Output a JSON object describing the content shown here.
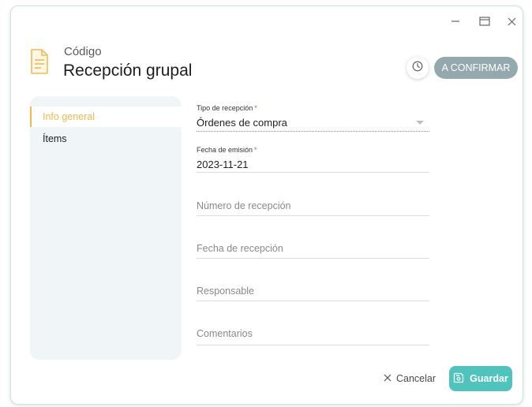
{
  "header": {
    "code_label": "Código",
    "title": "Recepción grupal",
    "confirm_label": "A CONFIRMAR"
  },
  "window_controls": [
    "minimize-icon",
    "maximize-icon",
    "close-icon"
  ],
  "sidebar": {
    "items": [
      {
        "label": "Info general",
        "active": true
      },
      {
        "label": "Ítems",
        "active": false
      }
    ]
  },
  "form": {
    "tipo_recepcion": {
      "label": "Tipo de recepción",
      "required": "*",
      "value": "Órdenes de compra"
    },
    "fecha_emision": {
      "label": "Fecha de emisión",
      "required": "*",
      "value": "2023-11-21"
    },
    "numero_recepcion": {
      "placeholder": "Número de recepción"
    },
    "fecha_recepcion": {
      "placeholder": "Fecha de recepción"
    },
    "responsable": {
      "placeholder": "Responsable"
    },
    "comentarios": {
      "placeholder": "Comentarios"
    }
  },
  "footer": {
    "cancel_label": "Cancelar",
    "save_label": "Guardar"
  },
  "colors": {
    "accent_teal": "#4fc4bd",
    "active_orange": "#f1b94c",
    "confirm_gray": "#93a9ae",
    "required_red": "#e2574c"
  }
}
